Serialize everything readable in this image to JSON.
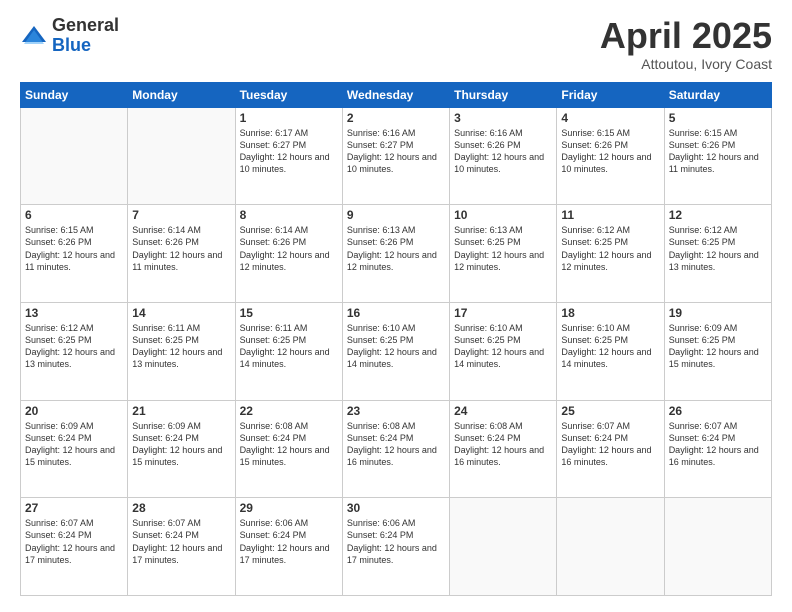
{
  "logo": {
    "general": "General",
    "blue": "Blue"
  },
  "header": {
    "title": "April 2025",
    "location": "Attoutou, Ivory Coast"
  },
  "weekdays": [
    "Sunday",
    "Monday",
    "Tuesday",
    "Wednesday",
    "Thursday",
    "Friday",
    "Saturday"
  ],
  "weeks": [
    [
      {
        "day": "",
        "info": ""
      },
      {
        "day": "",
        "info": ""
      },
      {
        "day": "1",
        "info": "Sunrise: 6:17 AM\nSunset: 6:27 PM\nDaylight: 12 hours and 10 minutes."
      },
      {
        "day": "2",
        "info": "Sunrise: 6:16 AM\nSunset: 6:27 PM\nDaylight: 12 hours and 10 minutes."
      },
      {
        "day": "3",
        "info": "Sunrise: 6:16 AM\nSunset: 6:26 PM\nDaylight: 12 hours and 10 minutes."
      },
      {
        "day": "4",
        "info": "Sunrise: 6:15 AM\nSunset: 6:26 PM\nDaylight: 12 hours and 10 minutes."
      },
      {
        "day": "5",
        "info": "Sunrise: 6:15 AM\nSunset: 6:26 PM\nDaylight: 12 hours and 11 minutes."
      }
    ],
    [
      {
        "day": "6",
        "info": "Sunrise: 6:15 AM\nSunset: 6:26 PM\nDaylight: 12 hours and 11 minutes."
      },
      {
        "day": "7",
        "info": "Sunrise: 6:14 AM\nSunset: 6:26 PM\nDaylight: 12 hours and 11 minutes."
      },
      {
        "day": "8",
        "info": "Sunrise: 6:14 AM\nSunset: 6:26 PM\nDaylight: 12 hours and 12 minutes."
      },
      {
        "day": "9",
        "info": "Sunrise: 6:13 AM\nSunset: 6:26 PM\nDaylight: 12 hours and 12 minutes."
      },
      {
        "day": "10",
        "info": "Sunrise: 6:13 AM\nSunset: 6:25 PM\nDaylight: 12 hours and 12 minutes."
      },
      {
        "day": "11",
        "info": "Sunrise: 6:12 AM\nSunset: 6:25 PM\nDaylight: 12 hours and 12 minutes."
      },
      {
        "day": "12",
        "info": "Sunrise: 6:12 AM\nSunset: 6:25 PM\nDaylight: 12 hours and 13 minutes."
      }
    ],
    [
      {
        "day": "13",
        "info": "Sunrise: 6:12 AM\nSunset: 6:25 PM\nDaylight: 12 hours and 13 minutes."
      },
      {
        "day": "14",
        "info": "Sunrise: 6:11 AM\nSunset: 6:25 PM\nDaylight: 12 hours and 13 minutes."
      },
      {
        "day": "15",
        "info": "Sunrise: 6:11 AM\nSunset: 6:25 PM\nDaylight: 12 hours and 14 minutes."
      },
      {
        "day": "16",
        "info": "Sunrise: 6:10 AM\nSunset: 6:25 PM\nDaylight: 12 hours and 14 minutes."
      },
      {
        "day": "17",
        "info": "Sunrise: 6:10 AM\nSunset: 6:25 PM\nDaylight: 12 hours and 14 minutes."
      },
      {
        "day": "18",
        "info": "Sunrise: 6:10 AM\nSunset: 6:25 PM\nDaylight: 12 hours and 14 minutes."
      },
      {
        "day": "19",
        "info": "Sunrise: 6:09 AM\nSunset: 6:25 PM\nDaylight: 12 hours and 15 minutes."
      }
    ],
    [
      {
        "day": "20",
        "info": "Sunrise: 6:09 AM\nSunset: 6:24 PM\nDaylight: 12 hours and 15 minutes."
      },
      {
        "day": "21",
        "info": "Sunrise: 6:09 AM\nSunset: 6:24 PM\nDaylight: 12 hours and 15 minutes."
      },
      {
        "day": "22",
        "info": "Sunrise: 6:08 AM\nSunset: 6:24 PM\nDaylight: 12 hours and 15 minutes."
      },
      {
        "day": "23",
        "info": "Sunrise: 6:08 AM\nSunset: 6:24 PM\nDaylight: 12 hours and 16 minutes."
      },
      {
        "day": "24",
        "info": "Sunrise: 6:08 AM\nSunset: 6:24 PM\nDaylight: 12 hours and 16 minutes."
      },
      {
        "day": "25",
        "info": "Sunrise: 6:07 AM\nSunset: 6:24 PM\nDaylight: 12 hours and 16 minutes."
      },
      {
        "day": "26",
        "info": "Sunrise: 6:07 AM\nSunset: 6:24 PM\nDaylight: 12 hours and 16 minutes."
      }
    ],
    [
      {
        "day": "27",
        "info": "Sunrise: 6:07 AM\nSunset: 6:24 PM\nDaylight: 12 hours and 17 minutes."
      },
      {
        "day": "28",
        "info": "Sunrise: 6:07 AM\nSunset: 6:24 PM\nDaylight: 12 hours and 17 minutes."
      },
      {
        "day": "29",
        "info": "Sunrise: 6:06 AM\nSunset: 6:24 PM\nDaylight: 12 hours and 17 minutes."
      },
      {
        "day": "30",
        "info": "Sunrise: 6:06 AM\nSunset: 6:24 PM\nDaylight: 12 hours and 17 minutes."
      },
      {
        "day": "",
        "info": ""
      },
      {
        "day": "",
        "info": ""
      },
      {
        "day": "",
        "info": ""
      }
    ]
  ]
}
